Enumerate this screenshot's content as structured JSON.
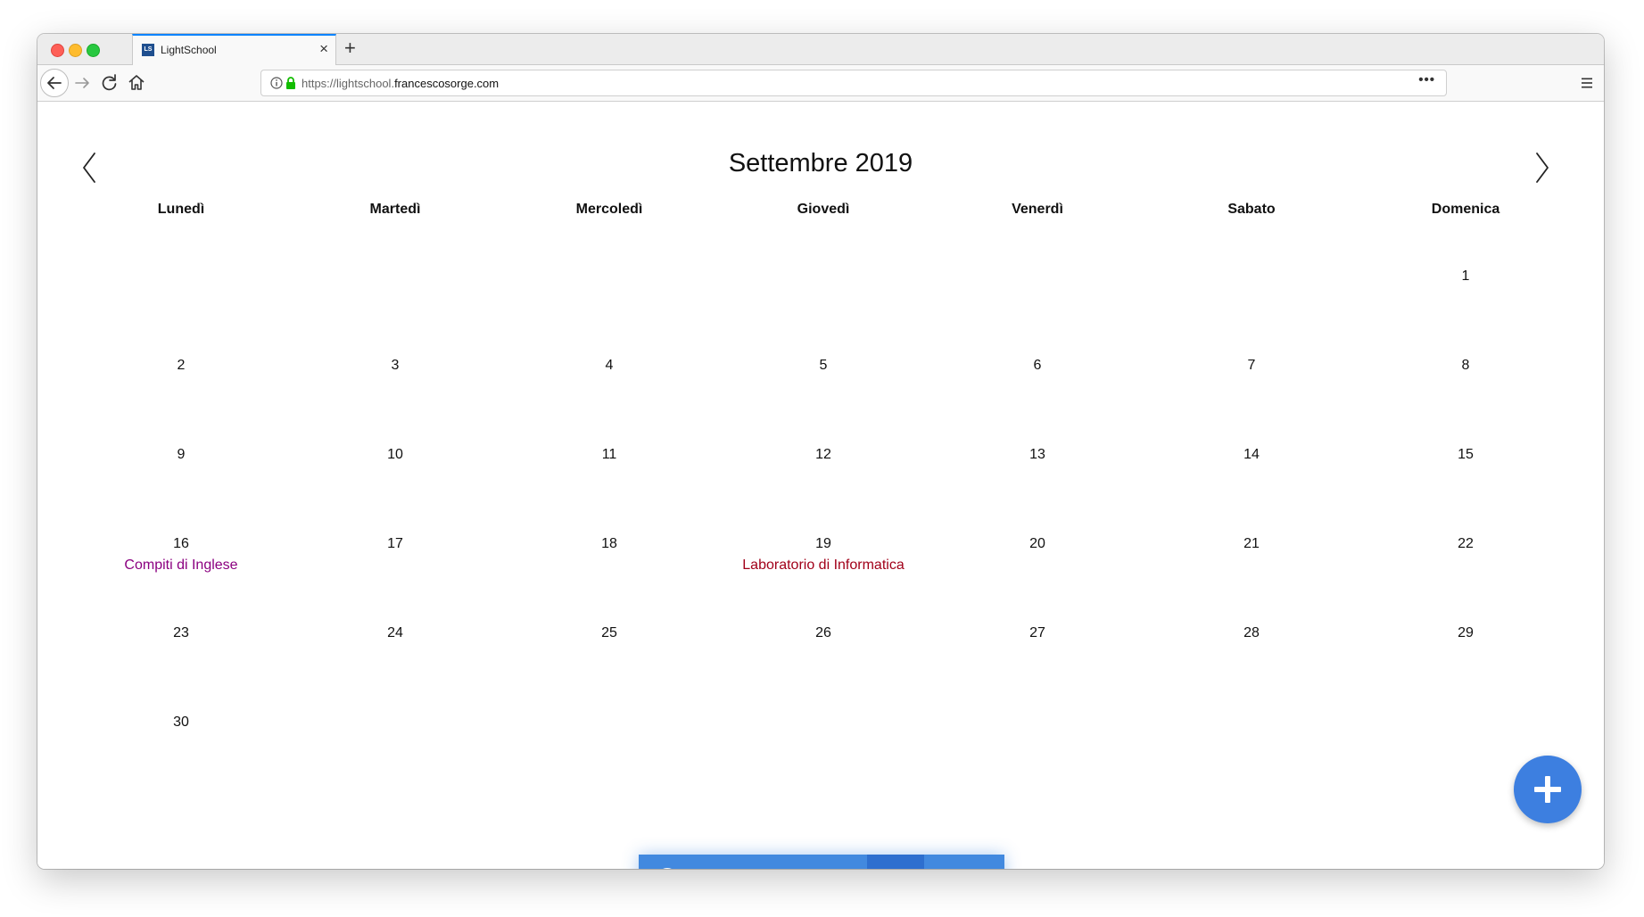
{
  "browser": {
    "tab_title": "LightSchool",
    "favicon_text": "LS",
    "url_prefix": "https://lightschool.",
    "url_host": "francescosorge.com",
    "page_actions": "•••"
  },
  "calendar": {
    "month_title": "Settembre 2019",
    "weekdays": [
      "Lunedì",
      "Martedì",
      "Mercoledì",
      "Giovedì",
      "Venerdì",
      "Sabato",
      "Domenica"
    ],
    "days": [
      "1",
      "2",
      "3",
      "4",
      "5",
      "6",
      "7",
      "8",
      "9",
      "10",
      "11",
      "12",
      "13",
      "14",
      "15",
      "16",
      "17",
      "18",
      "19",
      "20",
      "21",
      "22",
      "23",
      "24",
      "25",
      "26",
      "27",
      "28",
      "29",
      "30"
    ],
    "events": [
      {
        "day": "16",
        "title": "Compiti di Inglese",
        "color": "#8b0080"
      },
      {
        "day": "19",
        "title": "Laboratorio di Informatica",
        "color": "#a10019"
      }
    ]
  },
  "colors": {
    "accent": "#4289df",
    "fab": "#3d7fe0",
    "tab_highlight": "#0a84ff"
  },
  "dock": {
    "items": [
      "profile-avatar",
      "dashboard-icon",
      "document-icon",
      "share-icon",
      "calendar-icon",
      "messages-icon"
    ],
    "active": "calendar-icon"
  }
}
